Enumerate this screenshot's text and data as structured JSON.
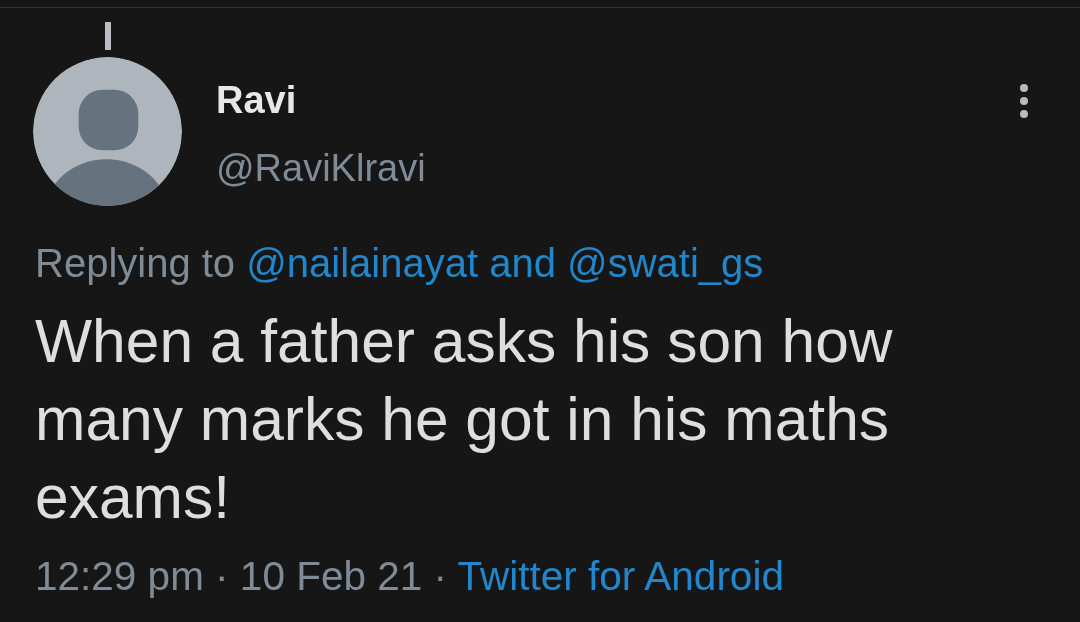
{
  "tweet": {
    "connected_above": true,
    "author": {
      "name": "Ravi",
      "handle": "@RaviKlravi"
    },
    "reply_context": {
      "label": "Replying to",
      "mentions": "@nailainayat and @swati_gs"
    },
    "text": "When a father asks his son how many marks he got in his maths exams!",
    "meta": {
      "timestamp": "12:29 pm · 10 Feb 21 ·",
      "source": "Twitter for Android"
    }
  }
}
